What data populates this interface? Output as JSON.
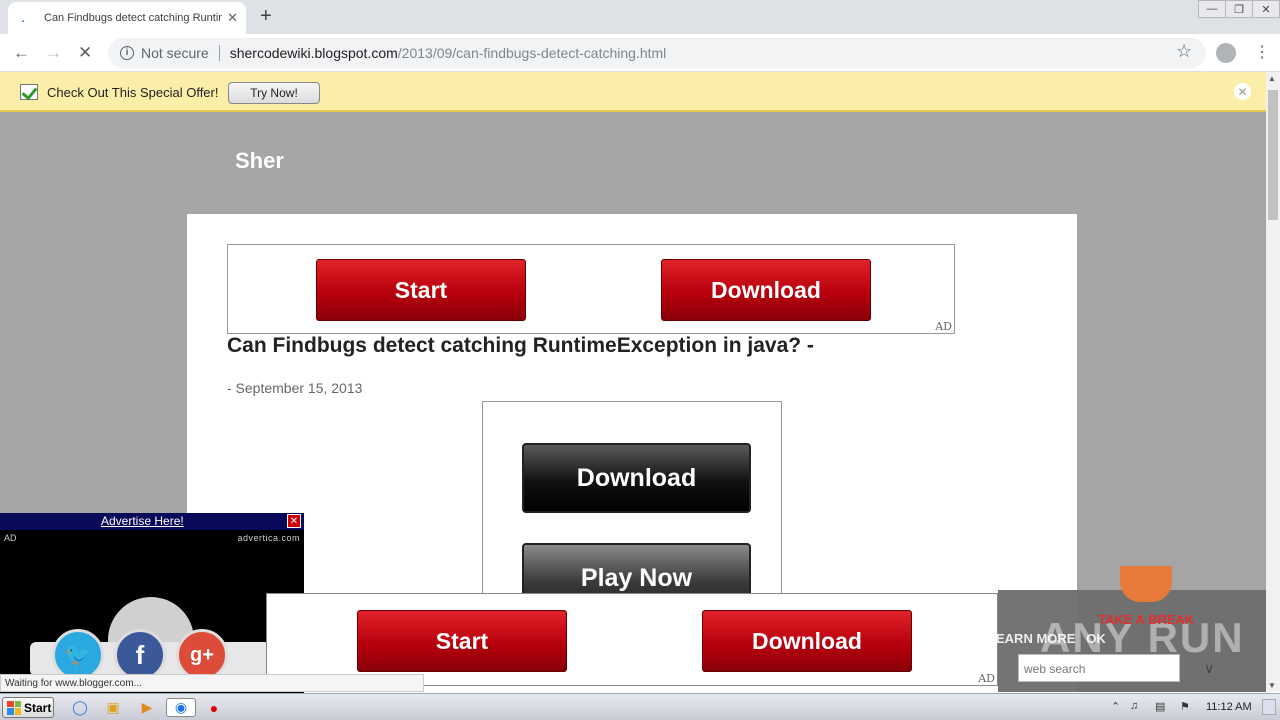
{
  "browser": {
    "tab_title": "Can Findbugs detect catching Runtim",
    "tab_close": "✕",
    "new_tab": "+",
    "window_controls": [
      "—",
      "❐",
      "✕"
    ],
    "not_secure": "Not secure",
    "url_host": "shercodewiki.blogspot.com",
    "url_path": "/2013/09/can-findbugs-detect-catching.html"
  },
  "infobar": {
    "message": "Check Out This Special Offer!",
    "button": "Try Now!",
    "close": "✕"
  },
  "page": {
    "brand": "Sher",
    "top_ad": {
      "start": "Start",
      "download": "Download",
      "tag": "AD"
    },
    "post_title": "Can Findbugs detect catching RuntimeException in java? -",
    "post_date": "- September 15, 2013",
    "mid_ad": {
      "download": "Download",
      "play_now": "Play Now"
    }
  },
  "advertica": {
    "header_link": "Advertise Here!",
    "close": "✕",
    "ad_label": "AD",
    "source": "advertica.com"
  },
  "social": {
    "twitter": "🐦",
    "facebook": "f",
    "google_plus": "g+"
  },
  "bottom_ad": {
    "start": "Start",
    "download": "Download",
    "tag": "AD"
  },
  "overlay": {
    "learn_more": "EARN MORE",
    "ok": "OK",
    "search_placeholder": "web search",
    "take_a_break": "TAKE A BREAK",
    "watermark": "ANY RUN"
  },
  "status_text": "Waiting for www.blogger.com...",
  "taskbar": {
    "start": "Start",
    "clock": "11:12 AM"
  },
  "colors": {
    "ad_red": "#c4000f",
    "infobar": "#fbeea9",
    "page_bg": "#a5a5a5"
  }
}
